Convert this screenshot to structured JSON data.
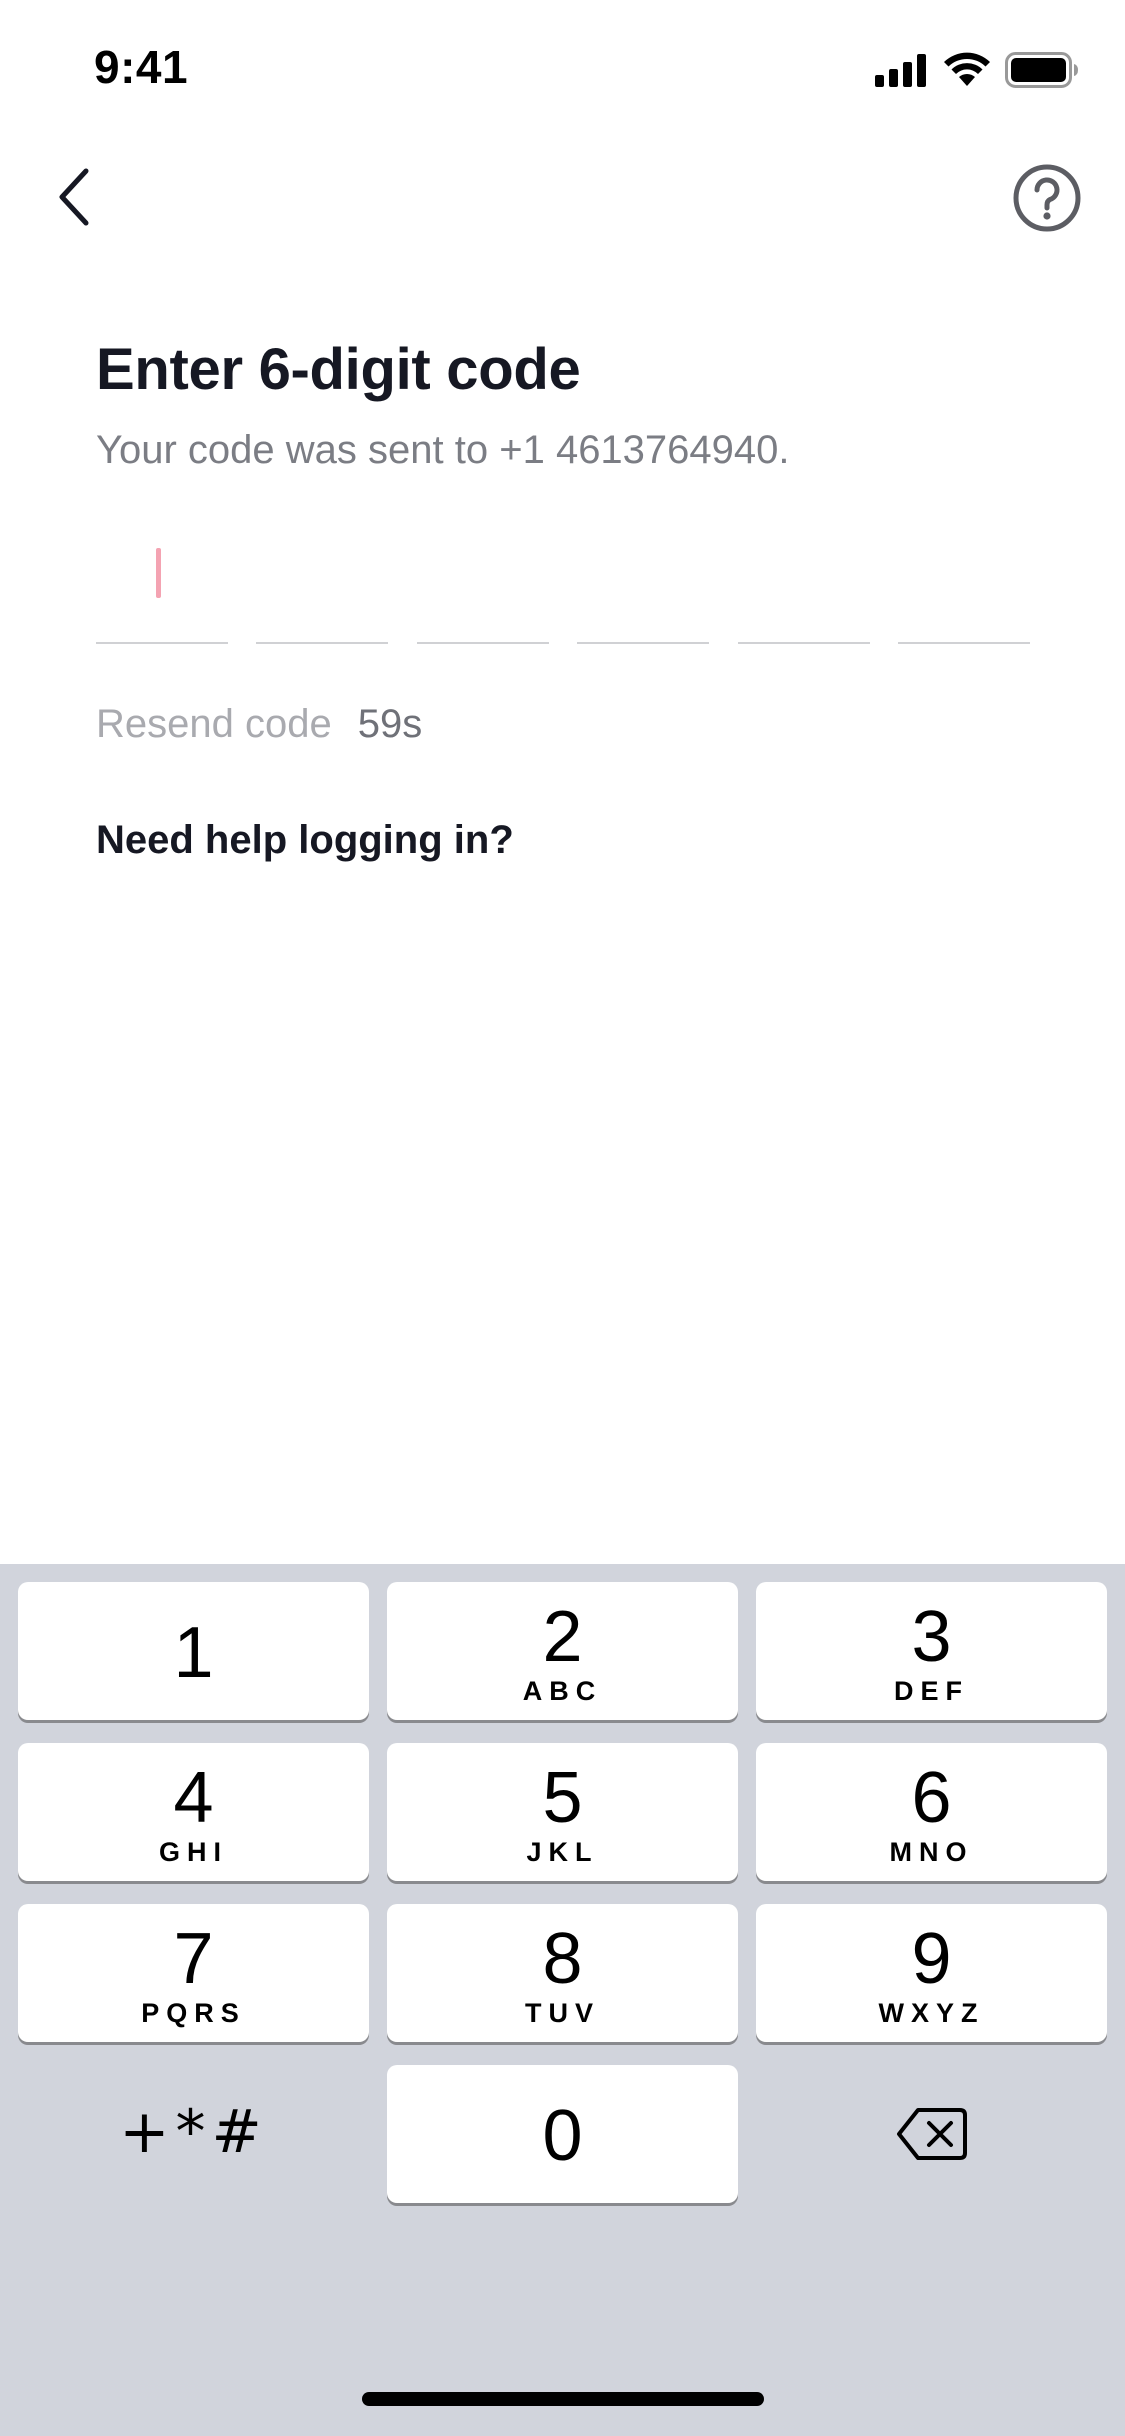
{
  "status_bar": {
    "time": "9:41"
  },
  "nav": {
    "back_icon": "chevron-left-icon",
    "help_icon": "question-circle-icon"
  },
  "content": {
    "title": "Enter 6-digit code",
    "subtitle": "Your code was sent to +1 4613764940.",
    "code_digits": [
      "",
      "",
      "",
      "",
      "",
      ""
    ],
    "resend_label": "Resend code",
    "resend_timer": "59s",
    "help_link": "Need help logging in?"
  },
  "colors": {
    "caret": "#f4a3b2",
    "keyboard_bg": "#d1d4dc",
    "text_primary": "#161823",
    "text_secondary": "#7b7d84"
  },
  "keyboard": {
    "keys": [
      {
        "num": "1",
        "letters": ""
      },
      {
        "num": "2",
        "letters": "ABC"
      },
      {
        "num": "3",
        "letters": "DEF"
      },
      {
        "num": "4",
        "letters": "GHI"
      },
      {
        "num": "5",
        "letters": "JKL"
      },
      {
        "num": "6",
        "letters": "MNO"
      },
      {
        "num": "7",
        "letters": "PQRS"
      },
      {
        "num": "8",
        "letters": "TUV"
      },
      {
        "num": "9",
        "letters": "WXYZ"
      },
      {
        "num": "0",
        "letters": ""
      }
    ],
    "symbols": "+*#",
    "delete_icon": "backspace-icon"
  }
}
